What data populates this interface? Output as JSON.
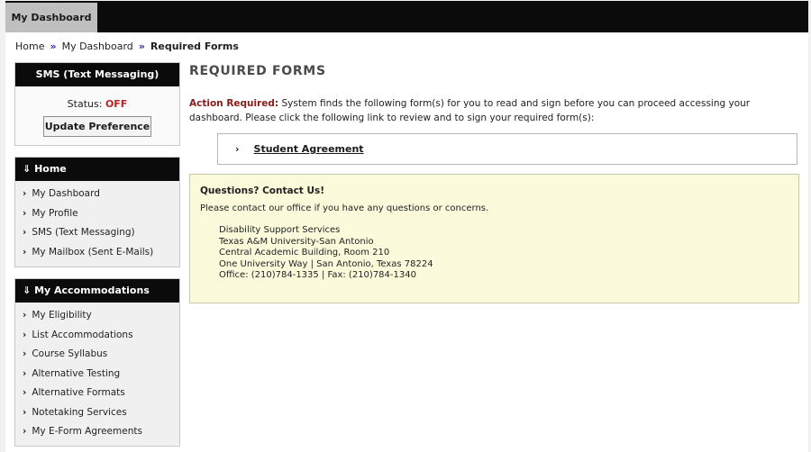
{
  "tabs": {
    "active_label": "My Dashboard"
  },
  "breadcrumb": {
    "home": "Home",
    "sep1": "»",
    "dashboard": "My Dashboard",
    "sep2": "»",
    "current": "Required Forms"
  },
  "sms": {
    "title": "SMS (Text Messaging)",
    "status_label": "Status:",
    "status_value": "OFF",
    "button": "Update Preference"
  },
  "home_nav": {
    "title": "Home",
    "items": [
      "My Dashboard",
      "My Profile",
      "SMS (Text Messaging)",
      "My Mailbox (Sent E-Mails)"
    ]
  },
  "acc_nav": {
    "title": "My Accommodations",
    "items": [
      "My Eligibility",
      "List Accommodations",
      "Course Syllabus",
      "Alternative Testing",
      "Alternative Formats",
      "Notetaking Services",
      "My E-Form Agreements"
    ]
  },
  "main": {
    "title": "REQUIRED FORMS",
    "action_label": "Action Required:",
    "action_text": "System finds the following form(s) for you to read and sign before you can proceed accessing your dashboard. Please click the following link to review and to sign your required form(s):",
    "form_link": "Student Agreement"
  },
  "contact": {
    "title": "Questions? Contact Us!",
    "intro": "Please contact our office if you have any questions or concerns.",
    "lines": [
      "Disability Support Services",
      "Texas A&M University-San Antonio",
      "Central Academic Building, Room 210",
      "One University Way | San Antonio, Texas 78224",
      "Office: (210)784-1335 | Fax: (210)784-1340"
    ]
  },
  "icons": {
    "double_chevron": "double-chevron-down-icon",
    "chevron": "chevron-right-icon"
  },
  "colors": {
    "header_bg": "#0b0b0b",
    "status_off": "#c0201e",
    "action_required": "#8b1a1a",
    "contact_bg": "#fbfbdc"
  }
}
